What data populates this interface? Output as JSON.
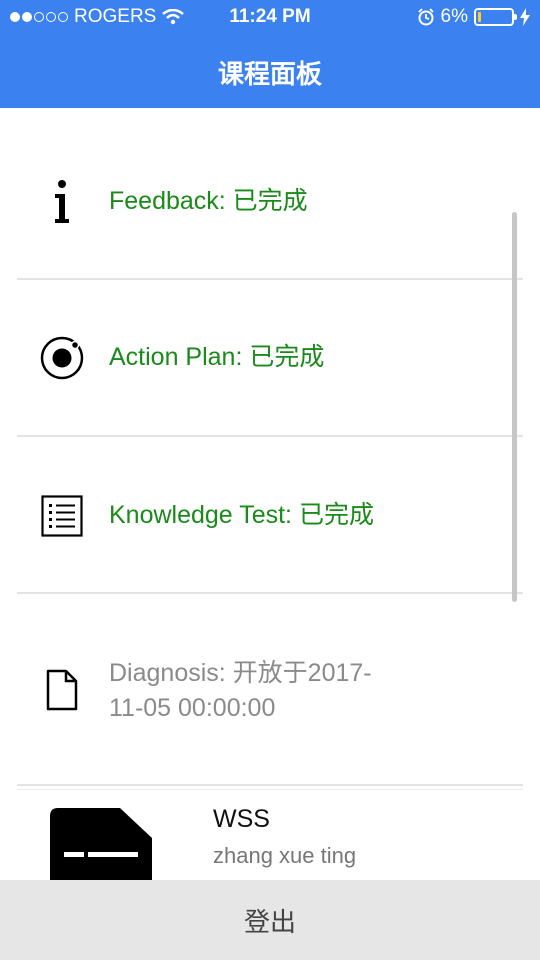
{
  "status_bar": {
    "carrier": "ROGERS",
    "time": "11:24 PM",
    "battery_text": "6%",
    "battery_level_percent": 6,
    "signal_bars_filled": 2,
    "signal_bars_total": 5
  },
  "nav": {
    "title": "课程面板"
  },
  "items": [
    {
      "label": "Feedback: 已完成",
      "icon": "info-icon",
      "status": "complete"
    },
    {
      "label": "Action Plan: 已完成",
      "icon": "target-icon",
      "status": "complete"
    },
    {
      "label": "Knowledge Test: 已完成",
      "icon": "list-icon",
      "status": "complete"
    },
    {
      "label_line1": "Diagnosis: 开放于2017-",
      "label_line2": "11-05 00:00:00",
      "icon": "document-icon",
      "status": "open"
    }
  ],
  "card": {
    "title": "WSS",
    "subtitle": "zhang xue ting",
    "icon": "document-icon"
  },
  "footer": {
    "logout_label": "登出"
  },
  "colors": {
    "accent": "#3b82f0",
    "complete": "#1a8a1a",
    "open": "#8a8a8a"
  }
}
